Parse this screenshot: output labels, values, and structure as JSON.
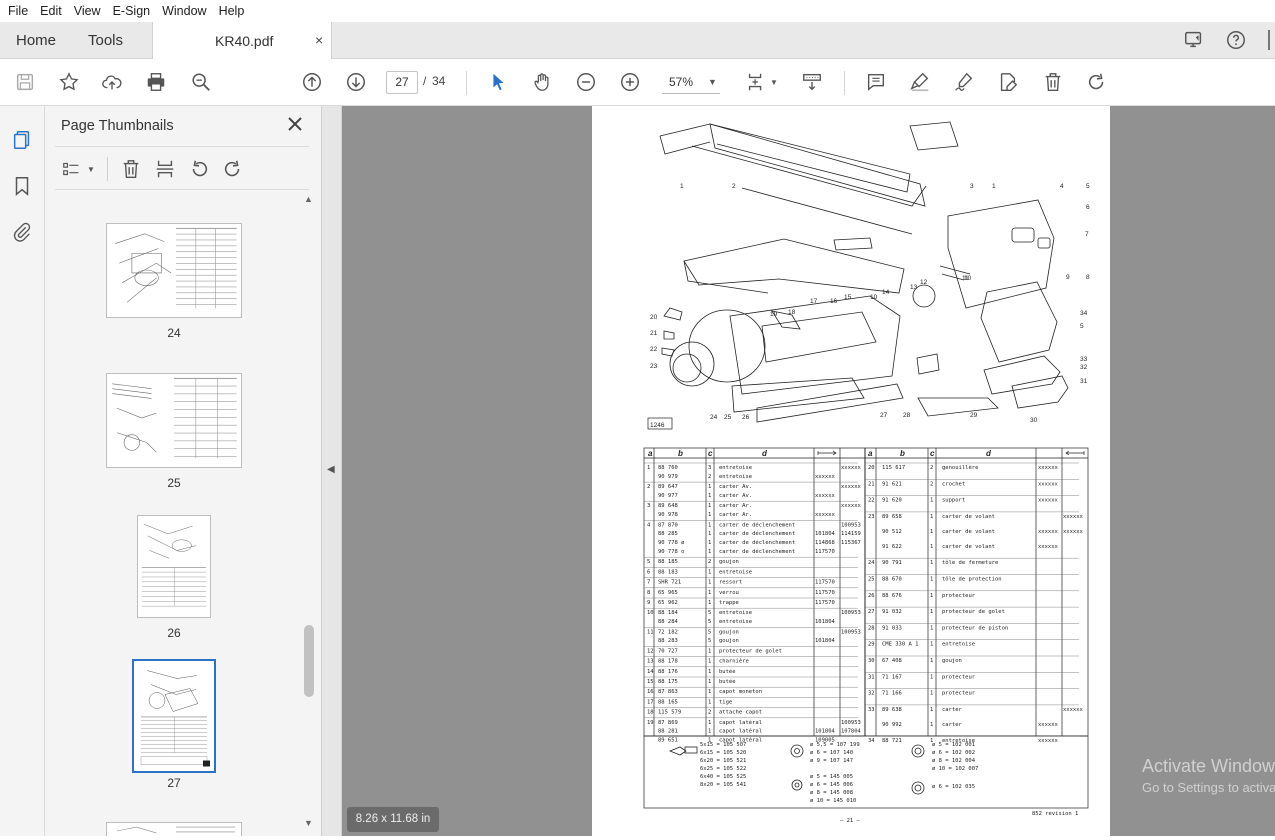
{
  "menu": [
    "File",
    "Edit",
    "View",
    "E-Sign",
    "Window",
    "Help"
  ],
  "tabs": {
    "home": "Home",
    "tools": "Tools",
    "document": "KR40.pdf",
    "close": "×"
  },
  "toolbar": {
    "current_page": "27",
    "page_sep": "/",
    "total_pages": "34",
    "zoom": "57%"
  },
  "thumbnails": {
    "title": "Page Thumbnails",
    "pages": [
      "24",
      "25",
      "26",
      "27"
    ],
    "selected": "27"
  },
  "doc": {
    "size_badge": "8.26 x 11.68 in",
    "figure_ref": "1246",
    "page_footer": "– 21 –",
    "revision": "852 revision 1",
    "table_headers": [
      "a",
      "b",
      "c",
      "d",
      "a",
      "b",
      "c",
      "d"
    ],
    "parts_left": [
      [
        "1",
        "88 760",
        "3",
        "entretoise",
        "",
        "xxxxxx"
      ],
      [
        "",
        "90 979",
        "2",
        "entretoise",
        "xxxxxx",
        ""
      ],
      [
        "2",
        "89 647",
        "1",
        "carter Av.",
        "",
        "xxxxxx"
      ],
      [
        "",
        "90 977",
        "1",
        "carter Av.",
        "xxxxxx",
        ""
      ],
      [
        "3",
        "89 648",
        "1",
        "carter Ar.",
        "",
        "xxxxxx"
      ],
      [
        "",
        "90 978",
        "1",
        "carter Ar.",
        "xxxxxx",
        ""
      ],
      [
        "4",
        "87 870",
        "1",
        "carter de déclenchement",
        "",
        "100953"
      ],
      [
        "",
        "88 285",
        "1",
        "carter de déclenchement",
        "101804",
        "114159"
      ],
      [
        "",
        "90 778 ø",
        "1",
        "carter de déclenchement",
        "114868",
        "115367"
      ],
      [
        "",
        "90 778 o",
        "1",
        "carter de déclenchement",
        "117570",
        ""
      ],
      [
        "5",
        "88 185",
        "2",
        "goujon",
        "",
        ""
      ],
      [
        "6",
        "88 183",
        "1",
        "entretoise",
        "",
        ""
      ],
      [
        "7",
        "SHR 721",
        "1",
        "ressort",
        "117570",
        ""
      ],
      [
        "8",
        "65 965",
        "1",
        "verrou",
        "117570",
        ""
      ],
      [
        "9",
        "65 962",
        "1",
        "trappe",
        "117570",
        ""
      ],
      [
        "10",
        "88 184",
        "5",
        "entretoise",
        "",
        "100953"
      ],
      [
        "",
        "88 284",
        "5",
        "entretoise",
        "101804",
        ""
      ],
      [
        "11",
        "72 182",
        "5",
        "goujon",
        "",
        "100953"
      ],
      [
        "",
        "88 283",
        "5",
        "goujon",
        "101804",
        ""
      ],
      [
        "12",
        "70 727",
        "1",
        "protecteur de golet",
        "",
        ""
      ],
      [
        "13",
        "88 178",
        "1",
        "charnière",
        "",
        ""
      ],
      [
        "14",
        "88 176",
        "1",
        "butée",
        "",
        ""
      ],
      [
        "15",
        "88 175",
        "1",
        "butée",
        "",
        ""
      ],
      [
        "16",
        "87 863",
        "1",
        "capot moneton",
        "",
        ""
      ],
      [
        "17",
        "88 165",
        "1",
        "tige",
        "",
        ""
      ],
      [
        "18",
        "115 579",
        "2",
        "attache capot",
        "",
        ""
      ],
      [
        "19",
        "87 869",
        "1",
        "capot latéral",
        "",
        "100953"
      ],
      [
        "",
        "88 281",
        "1",
        "capot latéral",
        "101804",
        "107804"
      ],
      [
        "",
        "89 651",
        "1",
        "capot latéral",
        "109005",
        ""
      ]
    ],
    "parts_right": [
      [
        "20",
        "115 617",
        "2",
        "genouillère",
        "xxxxxx",
        ""
      ],
      [
        "21",
        "91 621",
        "2",
        "crochet",
        "xxxxxx",
        ""
      ],
      [
        "22",
        "91 620",
        "1",
        "support",
        "xxxxxx",
        ""
      ],
      [
        "23",
        "89 658",
        "1",
        "carter de volant",
        "",
        "xxxxxx"
      ],
      [
        "",
        "90 512",
        "1",
        "carter de volant",
        "xxxxxx",
        "xxxxxx"
      ],
      [
        "",
        "91 622",
        "1",
        "carter de volant",
        "xxxxxx",
        ""
      ],
      [
        "24",
        "90 791",
        "1",
        "tôle de fermeture",
        "",
        ""
      ],
      [
        "25",
        "88 670",
        "1",
        "tôle de protection",
        "",
        ""
      ],
      [
        "26",
        "88 676",
        "1",
        "protecteur",
        "",
        ""
      ],
      [
        "27",
        "91 032",
        "1",
        "protecteur de golet",
        "",
        ""
      ],
      [
        "28",
        "91 033",
        "1",
        "protecteur de piston",
        "",
        ""
      ],
      [
        "29",
        "CME 330 A 1",
        "1",
        "entretoise",
        "",
        ""
      ],
      [
        "30",
        "67 408",
        "1",
        "goujon",
        "",
        ""
      ],
      [
        "31",
        "71 167",
        "1",
        "protecteur",
        "",
        ""
      ],
      [
        "32",
        "71 166",
        "1",
        "protecteur",
        "",
        ""
      ],
      [
        "33",
        "89 638",
        "1",
        "carter",
        "",
        "xxxxxx"
      ],
      [
        "",
        "90 992",
        "1",
        "carter",
        "xxxxxx",
        ""
      ],
      [
        "34",
        "88 721",
        "1",
        "entretoise",
        "xxxxxx",
        ""
      ]
    ],
    "fasteners_bolts": [
      "5x15 = 105 507",
      "6x15 = 105 520",
      "6x20 = 105 521",
      "6x25 = 105 522",
      "6x40 = 105 525",
      "8x20 = 105 541"
    ],
    "fasteners_washers_a": [
      "ø 5,5 = 107 199",
      "ø 6 = 107 140",
      "ø 9 = 107 147"
    ],
    "fasteners_washers_b": [
      "ø 5 = 145 005",
      "ø 6 = 145 006",
      "ø 8 = 145 008",
      "ø 10 = 145 010"
    ],
    "fasteners_nuts_a": [
      "ø 5 = 102 001",
      "ø 6 = 102 002",
      "ø 8 = 102 004",
      "ø 10 = 102 007"
    ],
    "fasteners_nuts_b": [
      "ø 6 = 102 035"
    ],
    "callouts": [
      "1",
      "2",
      "3",
      "1",
      "4",
      "5",
      "6",
      "7",
      "8",
      "9",
      "10",
      "11",
      "12",
      "13",
      "14",
      "10",
      "15",
      "16",
      "17",
      "18",
      "19",
      "20",
      "21",
      "22",
      "23",
      "24",
      "25",
      "26",
      "27",
      "28",
      "29",
      "30",
      "31",
      "32",
      "33",
      "5",
      "34"
    ]
  },
  "watermark": {
    "line1": "Activate Windows",
    "line2": "Go to Settings to activate Windows."
  }
}
